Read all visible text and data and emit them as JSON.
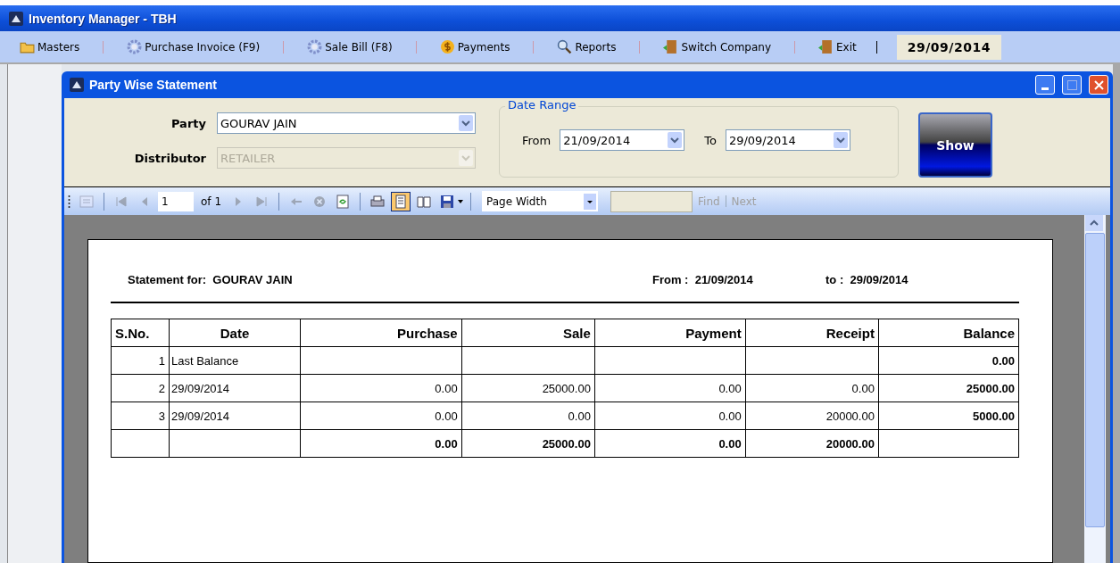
{
  "window": {
    "title": "Inventory Manager - TBH"
  },
  "menu": [
    {
      "label": "Masters"
    },
    {
      "label": "Purchase Invoice (F9)"
    },
    {
      "label": "Sale Bill (F8)"
    },
    {
      "label": "Payments"
    },
    {
      "label": "Reports"
    },
    {
      "label": "Switch Company"
    },
    {
      "label": "Exit"
    }
  ],
  "date": "29/09/2014",
  "dialog": {
    "title": "Party Wise Statement"
  },
  "form": {
    "party_label": "Party",
    "party": "GOURAV JAIN",
    "distributor_label": "Distributor",
    "distributor": "RETAILER",
    "distributor_disabled": true,
    "date_range_label": "Date Range",
    "from_label": "From",
    "from": "21/09/2014",
    "to_label": "To",
    "to": "29/09/2014",
    "show_button": "Show"
  },
  "toolbar": {
    "page": "1",
    "of_label": "of",
    "page_count": "1",
    "zoom": "Page Width",
    "find": "Find",
    "next": "Next",
    "find_disabled": true,
    "tools": [
      {
        "disabled": true,
        "selected": false
      },
      {
        "disabled": true,
        "selected": false
      },
      {
        "disabled": true,
        "selected": false
      },
      {
        "disabled": true,
        "selected": false
      },
      {
        "disabled": true,
        "selected": false
      },
      {
        "disabled": true,
        "selected": false
      },
      {
        "disabled": true,
        "selected": false
      },
      {
        "disabled": false,
        "selected": false
      },
      {
        "disabled": false,
        "selected": false
      },
      {
        "disabled": false,
        "selected": true
      },
      {
        "disabled": false,
        "selected": false
      },
      {
        "disabled": false,
        "selected": false
      }
    ]
  },
  "report": {
    "statement_label": "Statement for:",
    "party": "GOURAV JAIN",
    "from_label": "From :",
    "from": "21/09/2014",
    "to_label": "to :",
    "to": "29/09/2014",
    "columns": [
      {
        "label": "S.No.",
        "emphasis": false
      },
      {
        "label": "Date",
        "emphasis": false
      },
      {
        "label": "Purchase",
        "emphasis": false
      },
      {
        "label": "Sale",
        "emphasis": false
      },
      {
        "label": "Payment",
        "emphasis": false
      },
      {
        "label": "Receipt",
        "emphasis": false
      },
      {
        "label": "Balance",
        "emphasis": true
      }
    ],
    "rows": [
      {
        "kind": "data",
        "cells": [
          "1",
          "Last Balance",
          "",
          "",
          "",
          "",
          "0.00"
        ]
      },
      {
        "kind": "data",
        "cells": [
          "2",
          "29/09/2014",
          "0.00",
          "25000.00",
          "0.00",
          "0.00",
          "25000.00"
        ]
      },
      {
        "kind": "data",
        "cells": [
          "3",
          "29/09/2014",
          "0.00",
          "0.00",
          "0.00",
          "20000.00",
          "5000.00"
        ]
      },
      {
        "kind": "total",
        "cells": [
          "",
          "",
          "0.00",
          "25000.00",
          "0.00",
          "20000.00",
          ""
        ]
      }
    ]
  }
}
